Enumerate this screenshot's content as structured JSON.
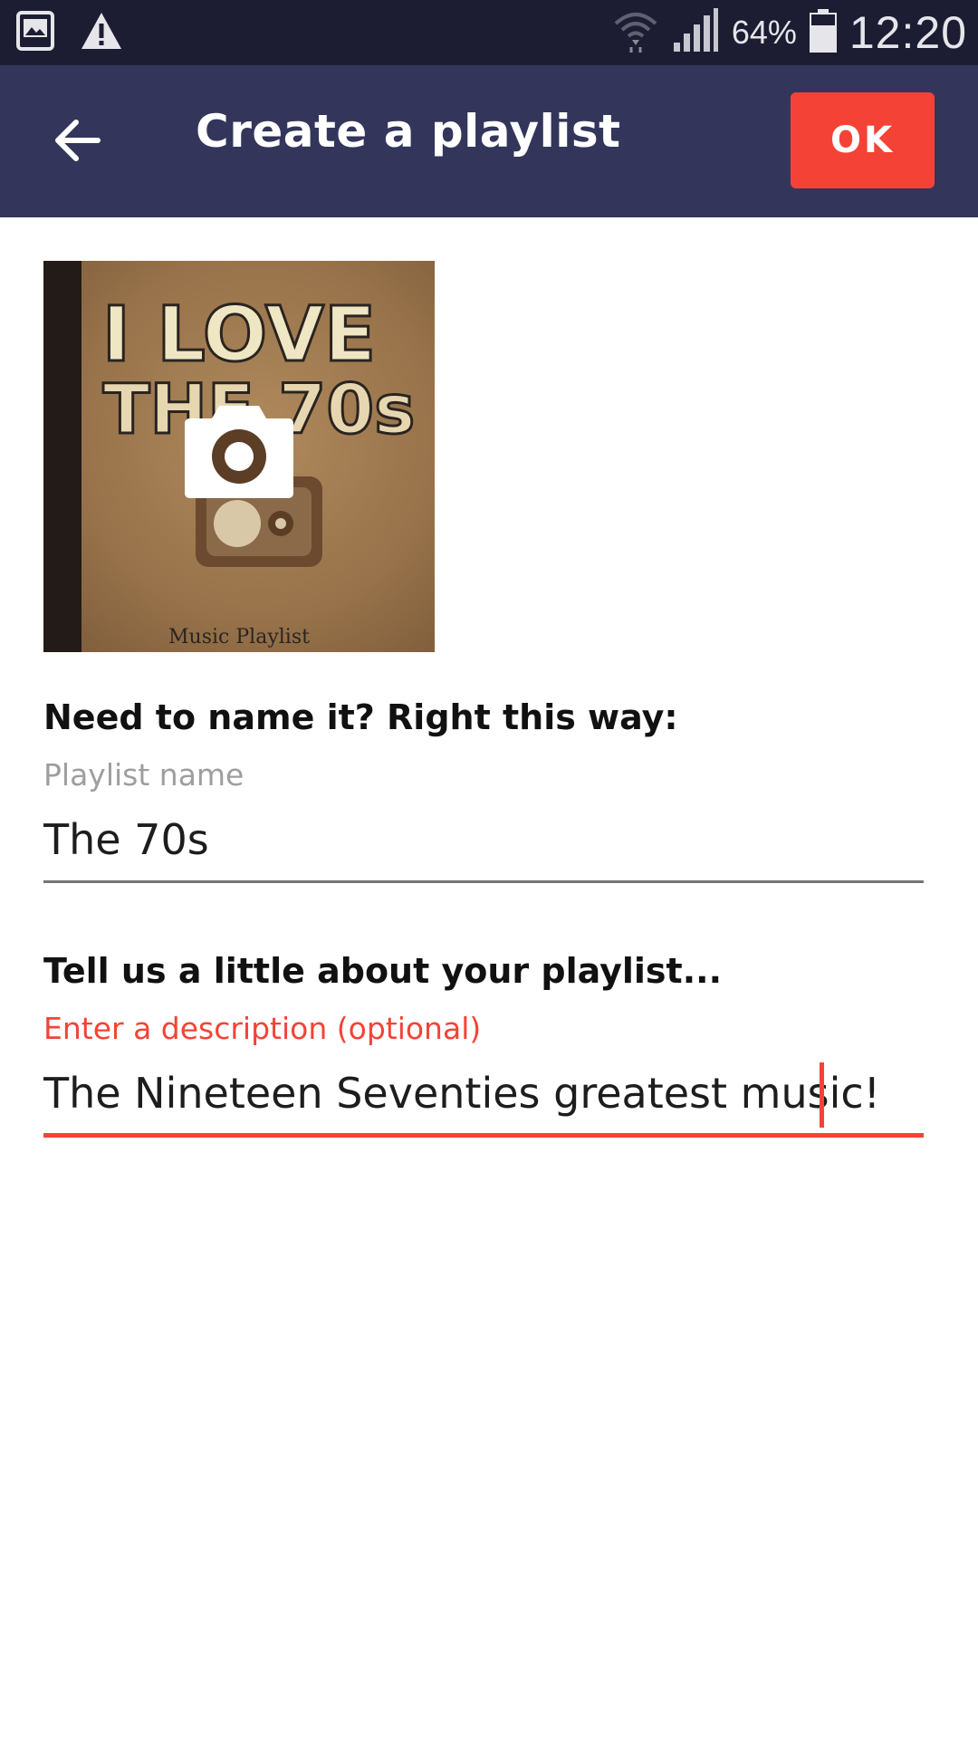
{
  "status_bar": {
    "battery_percent": "64%",
    "time": "12:20",
    "icons": [
      "gallery-icon",
      "warning-icon",
      "wifi-icon",
      "signal-icon",
      "battery-icon"
    ]
  },
  "app_bar": {
    "title": "Create a playlist",
    "ok_label": "OK",
    "back_icon": "arrow-back-icon"
  },
  "cover": {
    "art_line1": "I LOVE",
    "art_line2": "THE 70s",
    "art_caption": "Music Playlist",
    "overlay_icon": "camera-icon"
  },
  "name_section": {
    "heading": "Need to name it? Right this way:",
    "label": "Playlist name",
    "value": "The 70s"
  },
  "description_section": {
    "heading": "Tell us a little about your playlist...",
    "label": "Enter a description (optional)",
    "value": "The Nineteen Seventies greatest music!"
  },
  "colors": {
    "status_bar": "#1c1d33",
    "app_bar": "#33365a",
    "accent": "#f44336",
    "label_gray": "#9e9e9e"
  }
}
